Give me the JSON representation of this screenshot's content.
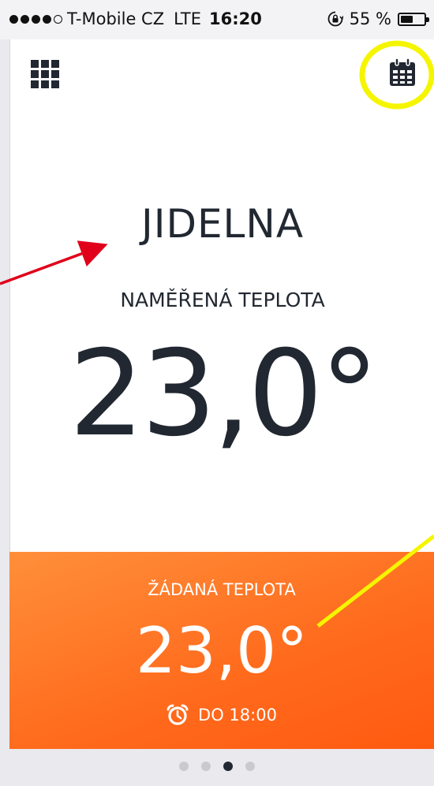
{
  "status_bar": {
    "carrier": "T-Mobile CZ",
    "network": "LTE",
    "time": "16:20",
    "battery_text": "55 %",
    "battery_level": 0.55
  },
  "header": {
    "menu_icon": "grid-icon",
    "calendar_icon": "calendar-icon"
  },
  "room": {
    "name": "JIDELNA",
    "measured_label": "NAMĚŘENÁ TEPLOTA",
    "measured_value": "23,0°"
  },
  "target": {
    "label": "ŽÁDANÁ TEPLOTA",
    "value": "23,0°",
    "schedule_text": "DO 18:00",
    "schedule_icon": "alarm-clock-icon"
  },
  "pagination": {
    "count": 4,
    "active_index": 2
  },
  "colors": {
    "text_dark": "#222831",
    "panel_orange": "#ff6a1c",
    "annotation_red": "#e0001a",
    "annotation_yellow": "#f5f500"
  }
}
